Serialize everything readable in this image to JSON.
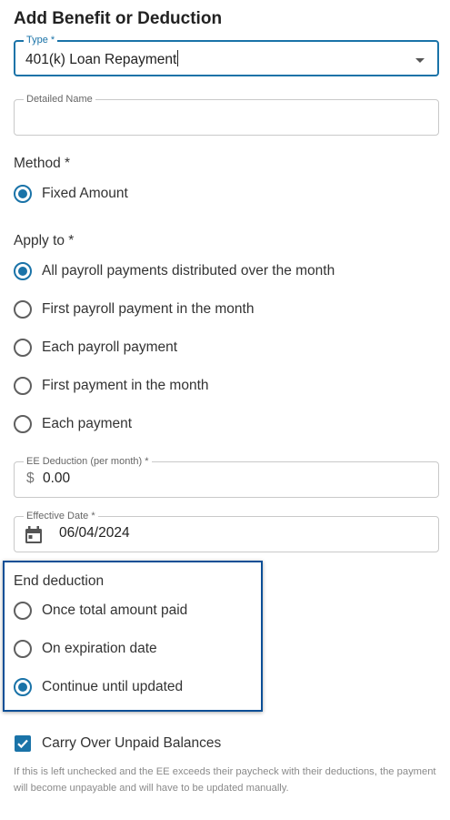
{
  "form": {
    "title": "Add Benefit or Deduction",
    "type_field": {
      "label": "Type *",
      "value": "401(k) Loan Repayment"
    },
    "detailed_name_field": {
      "label": "Detailed Name",
      "value": ""
    },
    "method": {
      "label": "Method *",
      "options": [
        {
          "label": "Fixed Amount",
          "selected": true
        }
      ]
    },
    "apply_to": {
      "label": "Apply to *",
      "options": [
        {
          "label": "All payroll payments distributed over the month",
          "selected": true
        },
        {
          "label": "First payroll payment in the month",
          "selected": false
        },
        {
          "label": "Each payroll payment",
          "selected": false
        },
        {
          "label": "First payment in the month",
          "selected": false
        },
        {
          "label": "Each payment",
          "selected": false
        }
      ]
    },
    "ee_deduction_field": {
      "label": "EE Deduction (per month) *",
      "currency": "$",
      "value": "0.00"
    },
    "effective_date_field": {
      "label": "Effective Date *",
      "value": "06/04/2024",
      "icon": "calendar-icon"
    },
    "end_deduction": {
      "label": "End deduction",
      "options": [
        {
          "label": "Once total amount paid",
          "selected": false
        },
        {
          "label": "On expiration date",
          "selected": false
        },
        {
          "label": "Continue until updated",
          "selected": true
        }
      ]
    },
    "carry_over": {
      "label": "Carry Over Unpaid Balances",
      "checked": true,
      "help_text": "If this is left unchecked and the EE exceeds their paycheck with their deductions, the payment will become unpayable and will have to be updated manually."
    }
  },
  "colors": {
    "accent": "#1a73a8",
    "highlight_border": "#0b4f96"
  }
}
